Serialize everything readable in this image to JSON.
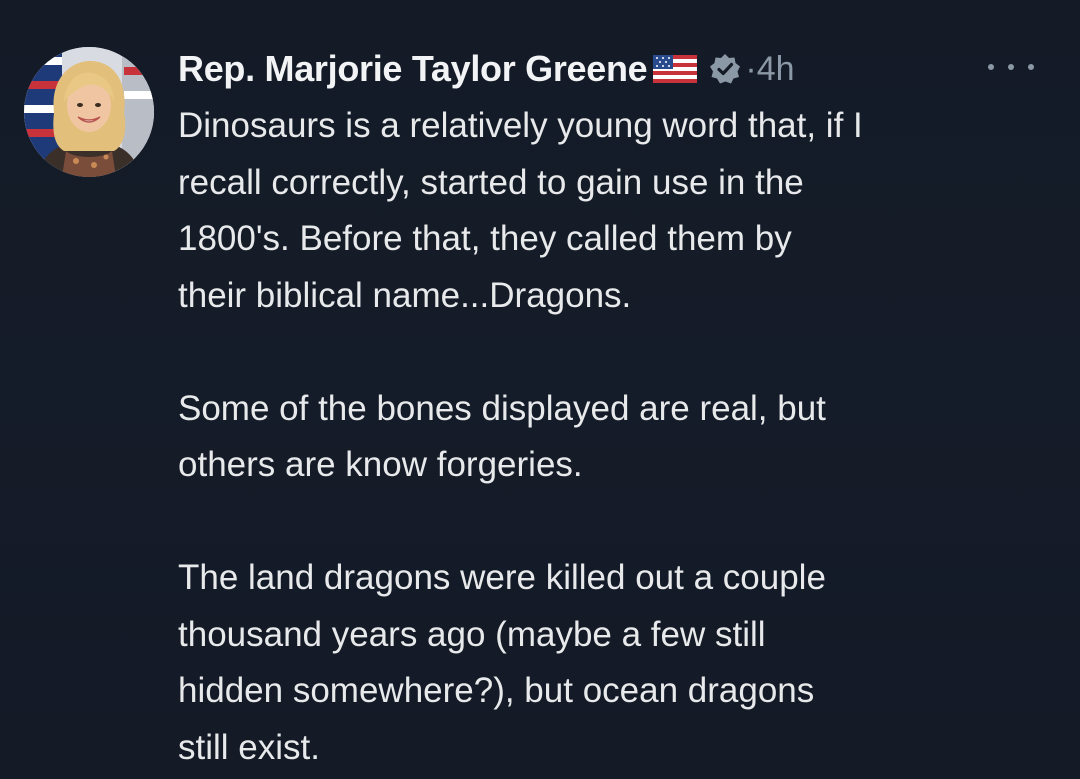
{
  "tweet": {
    "display_name": "Rep. Marjorie Taylor Greene",
    "timestamp": "·4h",
    "flag_icon": "us-flag-icon",
    "verified_icon": "verified-badge-icon",
    "more_icon": "more-options-icon",
    "paragraphs": [
      {
        "lines": [
          "Dinosaurs is a relatively young word that, if I",
          "recall correctly, started to gain use in the",
          "1800's. Before that, they called them by",
          "their biblical name...Dragons."
        ]
      },
      {
        "lines": [
          "Some of the bones displayed are real, but",
          "others are know forgeries."
        ]
      },
      {
        "lines": [
          "The land dragons were killed out a couple",
          "thousand years ago (maybe a few still",
          "hidden somewhere?), but ocean dragons",
          "still exist."
        ]
      }
    ]
  },
  "colors": {
    "background": "#151c28",
    "text": "#e7e9ea",
    "secondary_text": "#8b98a5",
    "verified_badge": "#8b98a5"
  }
}
